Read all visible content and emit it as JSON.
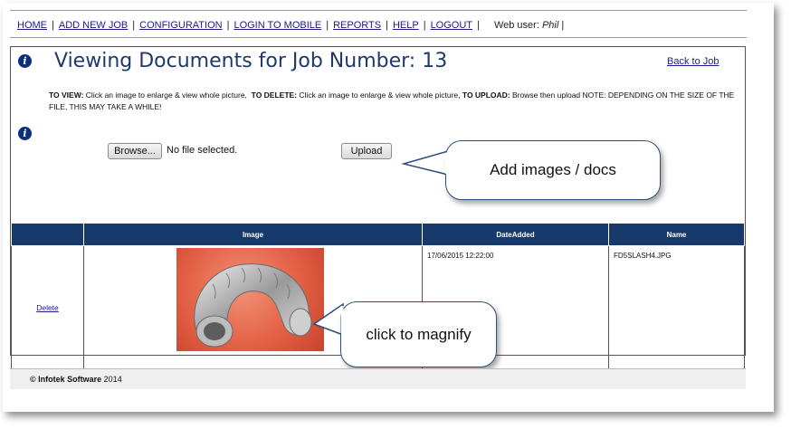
{
  "nav": {
    "items": [
      "HOME",
      "ADD NEW JOB",
      "CONFIGURATION",
      "LOGIN TO MOBILE",
      "REPORTS",
      "HELP",
      "LOGOUT"
    ],
    "web_user_label": "Web user:",
    "web_user_name": "Phil"
  },
  "header": {
    "title": "Viewing Documents for Job Number: 13",
    "back_link": "Back to Job"
  },
  "instructions": {
    "view_label": "TO VIEW:",
    "view_text": "Click an image to enlarge & view whole picture,",
    "delete_label": "TO DELETE:",
    "delete_text": "Click an image to enlarge & view whole picture,",
    "upload_label": "TO UPLOAD:",
    "upload_text": "Browse then upload NOTE: DEPENDING ON THE SIZE OF THE FILE, THIS MAY TAKE A WHILE!"
  },
  "upload": {
    "browse_label": "Browse...",
    "no_file_text": "No file selected.",
    "upload_label": "Upload"
  },
  "callouts": {
    "add": "Add images / docs",
    "magnify": "click to magnify"
  },
  "table": {
    "columns": [
      "",
      "Image",
      "DateAdded",
      "Name"
    ],
    "rows": [
      {
        "action": "Delete",
        "date_added": "17/06/2015 12:22:00",
        "name": "FD5SLASH4.JPG"
      }
    ]
  },
  "footer": {
    "copyright": "© Infotek Software",
    "year": "2014"
  },
  "colors": {
    "header_bar": "#153a6b",
    "title": "#1f3a6a",
    "link": "#1a1a8c",
    "callout_border": "#2b4f7d",
    "image_bg": "#e36146"
  },
  "icons": [
    "info-icon",
    "duct-hose-image"
  ]
}
